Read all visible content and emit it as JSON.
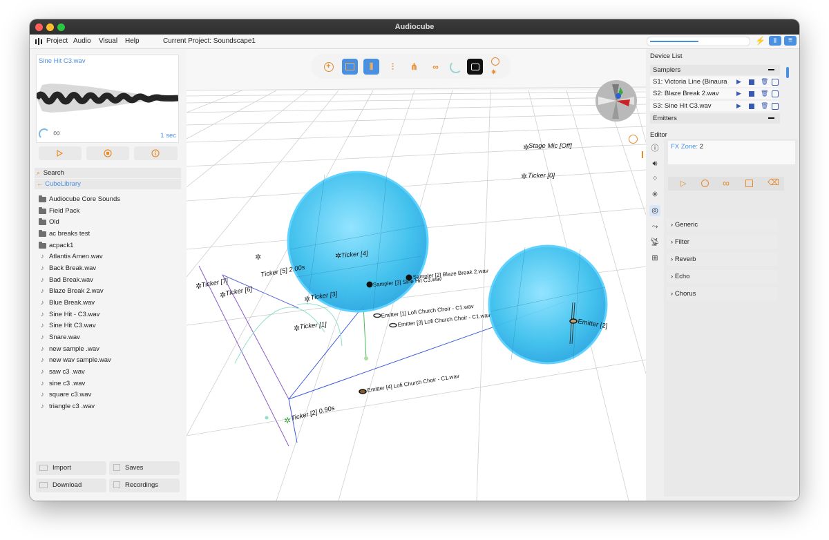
{
  "app": {
    "title": "Audiocube"
  },
  "menu": {
    "items": [
      "Project",
      "Audio",
      "Visual",
      "Help"
    ],
    "current_project": "Current Project: Soundscape1"
  },
  "preview": {
    "file": "Sine Hit C3.wav",
    "duration": "1 sec",
    "loop_symbol": "∞"
  },
  "browser": {
    "search_label": "Search",
    "back_label": "CubeLibrary",
    "folders": [
      "Audiocube Core Sounds",
      "Field Pack",
      "Old",
      "ac breaks test",
      "acpack1"
    ],
    "files": [
      "Atlantis Amen.wav",
      "Back Break.wav",
      "Bad Break.wav",
      "Blaze Break 2.wav",
      "Blue Break.wav",
      "Sine Hit - C3.wav",
      "Sine Hit C3.wav",
      "Snare.wav",
      "new sample .wav",
      "new wav sample.wav",
      "saw c3 .wav",
      "sine c3 .wav",
      "square c3.wav",
      "triangle c3 .wav"
    ]
  },
  "bottom_buttons": {
    "import": "Import",
    "saves": "Saves",
    "download": "Download",
    "recordings": "Recordings"
  },
  "device_list": {
    "title": "Device List",
    "samplers_header": "Samplers",
    "samplers": [
      "S1: Victoria Line (Binaura",
      "S2: Blaze Break 2.wav",
      "S3: Sine Hit C3.wav"
    ],
    "emitters_header": "Emitters"
  },
  "editor": {
    "title": "Editor",
    "fx_zone_label": "FX Zone:",
    "fx_zone_value": "2",
    "sections": [
      "Generic",
      "Filter",
      "Reverb",
      "Echo",
      "Chorus"
    ]
  },
  "scene": {
    "labels": {
      "stage_mic": "Stage Mic [Off]",
      "ticker0": "Ticker [0]",
      "ticker1": "Ticker [1]",
      "ticker2": "Ticker [2] 0.90s",
      "ticker3": "Ticker [3]",
      "ticker4": "Ticker [4]",
      "ticker5": "Ticker [5] 2.00s",
      "ticker6": "Ticker [6]",
      "ticker7": "Ticker [7]",
      "sampler2": "Sampler [2] Blaze Break 2.wav",
      "sampler3": "Sampler [3] Sine Hit C3.wav",
      "emitter1": "Emitter [1] Lofi Church Choir - C1.wav",
      "emitter2": "Emitter [2]",
      "emitter3": "Emitter [3] Lofi Church Choir - C1.wav",
      "emitter4": "Emitter [4] Lofi Church Choir - C1.wav"
    }
  },
  "colors": {
    "accent": "#4a90e2",
    "orange": "#e8892a",
    "sphere": "#3cc4f0",
    "active_blue": "#4a90e2"
  }
}
